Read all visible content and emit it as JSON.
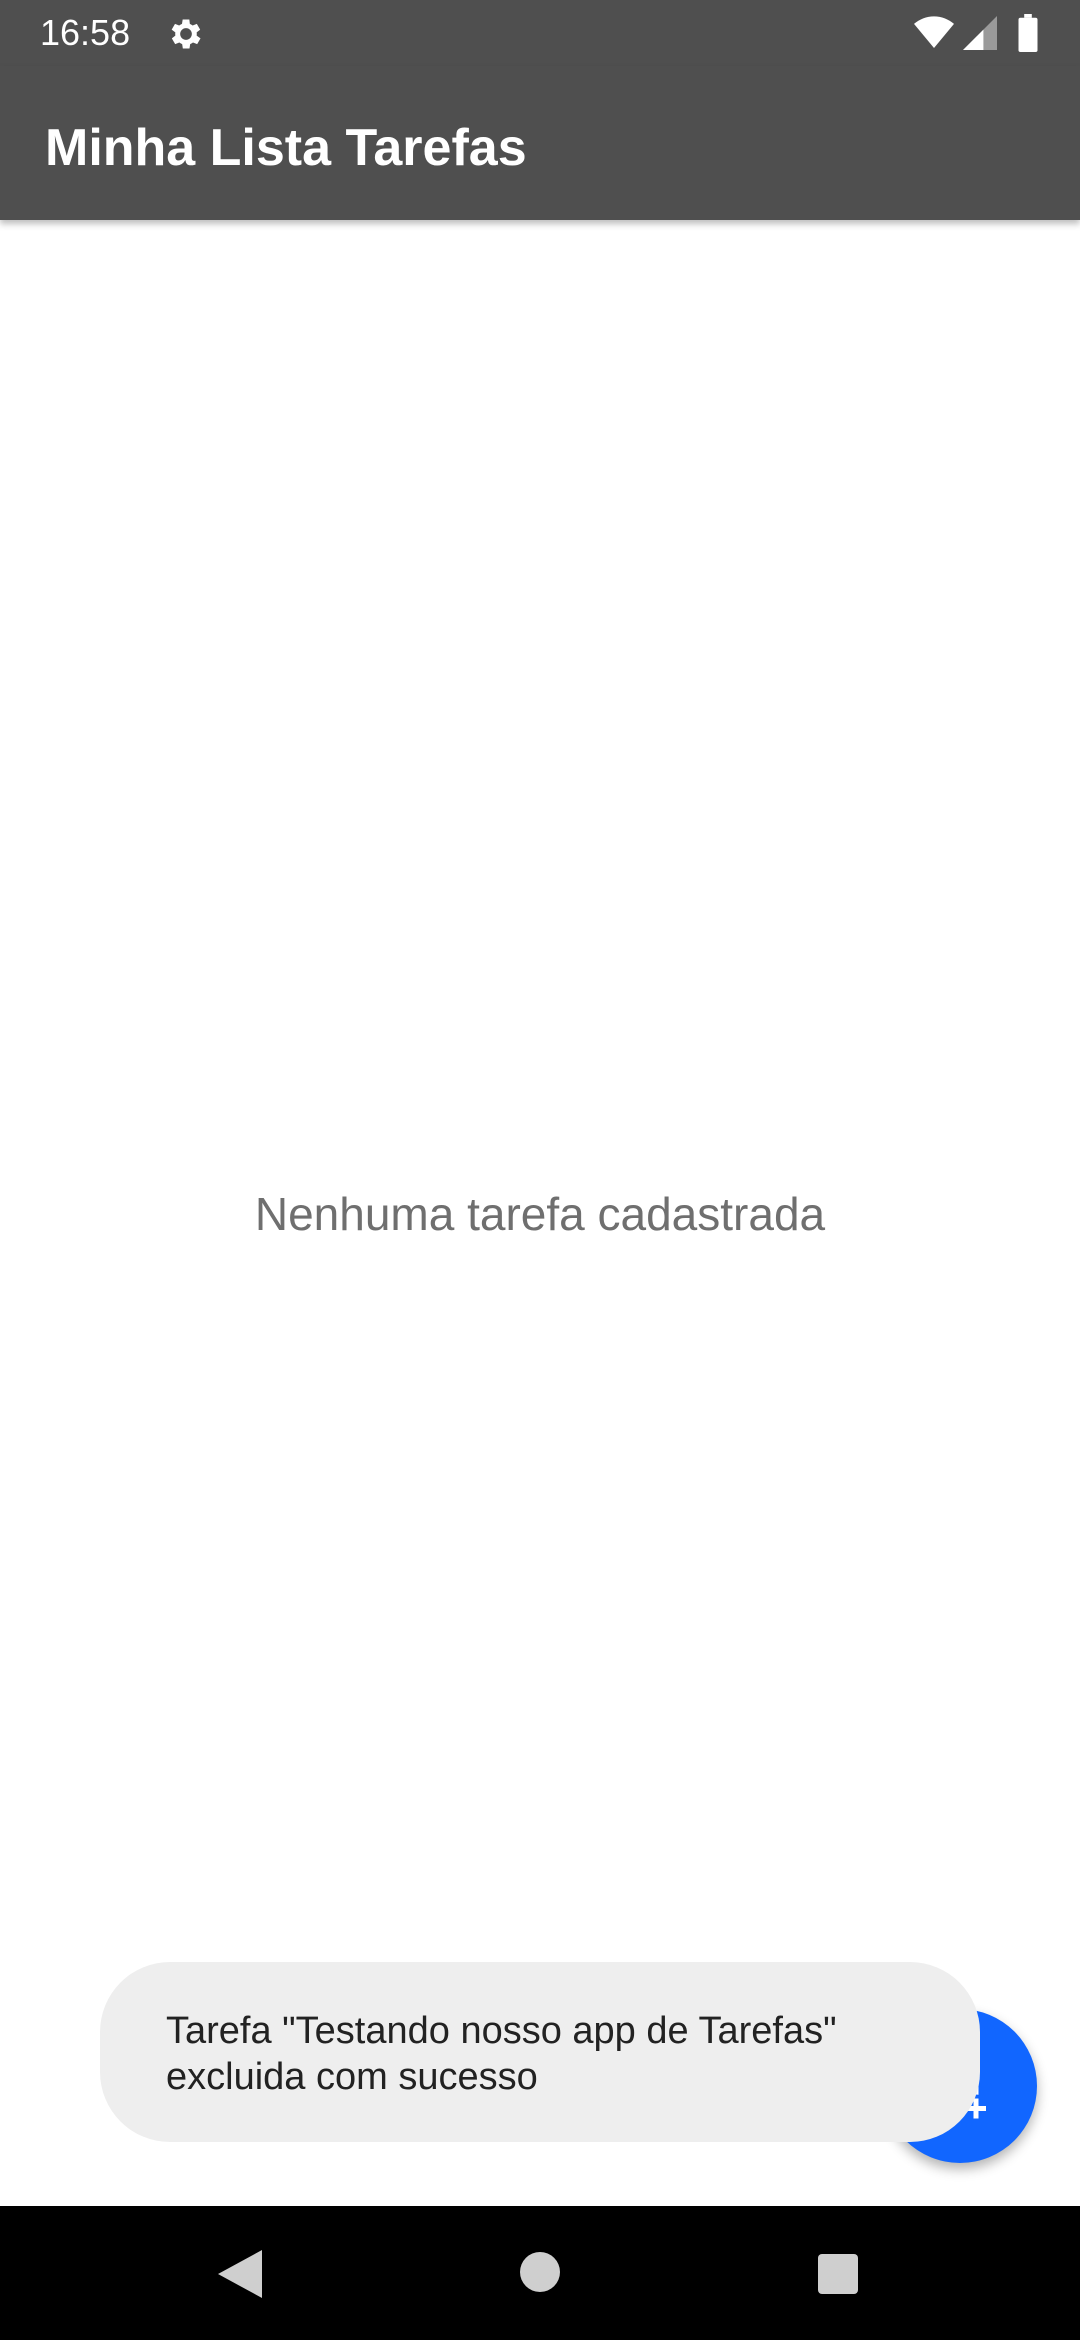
{
  "status_bar": {
    "time": "16:58",
    "icons": [
      "settings-icon",
      "wifi-icon",
      "signal-icon",
      "battery-icon"
    ]
  },
  "app_bar": {
    "title": "Minha Lista Tarefas"
  },
  "main": {
    "empty_message": "Nenhuma tarefa cadastrada"
  },
  "toast": {
    "line1": "Tarefa \"Testando nosso app de Tarefas\"",
    "line2": "excluida com sucesso"
  },
  "fab": {
    "icon": "add-document-icon"
  },
  "nav_bar": {
    "icons": [
      "back-icon",
      "home-icon",
      "recents-icon"
    ]
  },
  "colors": {
    "app_bar": "#4f4f4f",
    "fab": "#1166ff",
    "toast_bg": "#eeeeee",
    "empty_text": "#6f6f6f",
    "nav_bar": "#000000"
  }
}
